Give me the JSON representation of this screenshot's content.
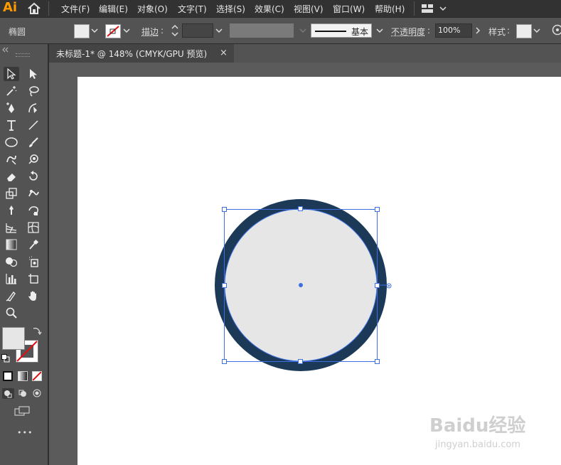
{
  "app": {
    "logo": "Ai"
  },
  "menu": [
    "文件(F)",
    "编辑(E)",
    "对象(O)",
    "文字(T)",
    "选择(S)",
    "效果(C)",
    "视图(V)",
    "窗口(W)",
    "帮助(H)"
  ],
  "control_bar": {
    "object_type": "椭圆",
    "stroke_label": "描边",
    "stroke_profile": "基本",
    "opacity_label": "不透明度",
    "opacity_value": "100%",
    "style_label": "样式"
  },
  "document_tab": {
    "title": "未标题-1* @ 148% (CMYK/GPU 预览)",
    "close": "×"
  },
  "more_tools": "•••",
  "colors": {
    "fill": "#e6e6e6",
    "stroke_ring": "#1c3a57",
    "selection": "#3d6fe0",
    "accent": "#ff9a00"
  },
  "watermark": {
    "brand": "Baidu经验",
    "url": "jingyan.baidu.com"
  }
}
